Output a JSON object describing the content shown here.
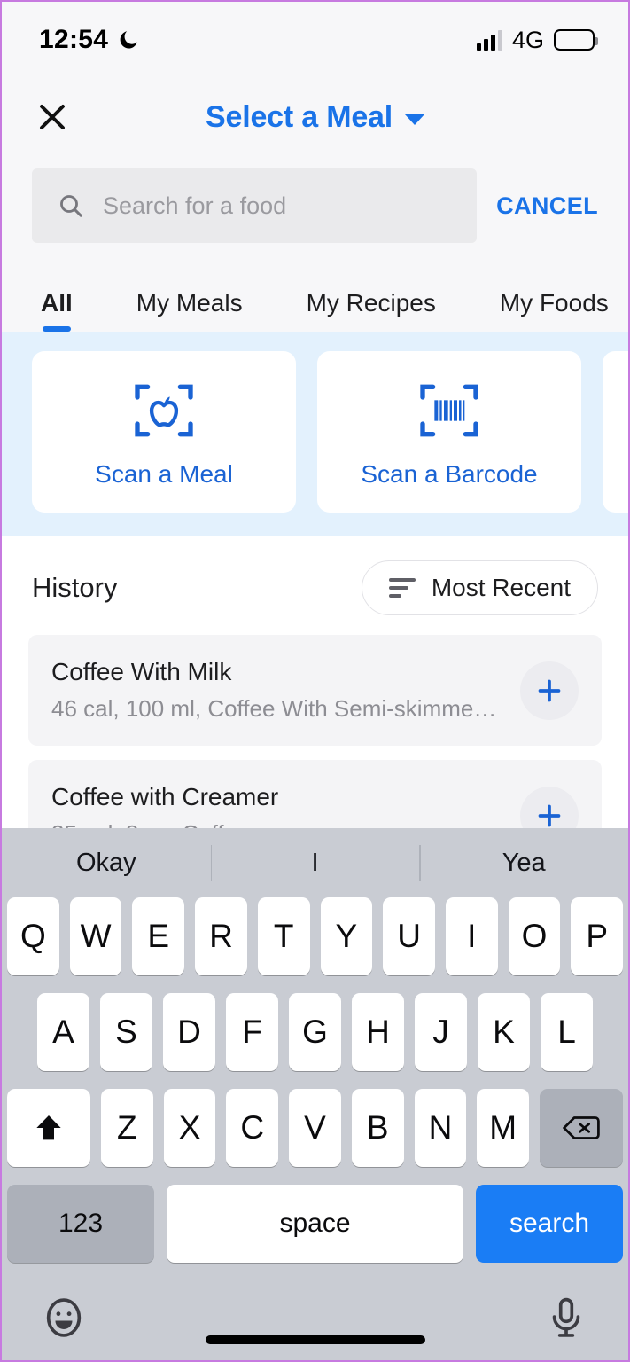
{
  "status_bar": {
    "time": "12:54",
    "dnd_icon": "moon-icon",
    "signal_icon": "cellular-bars-icon",
    "network": "4G",
    "battery_icon": "battery-icon"
  },
  "nav": {
    "close_icon": "close-x-icon",
    "title": "Select a Meal",
    "caret_icon": "chevron-down-icon"
  },
  "search": {
    "icon": "search-icon",
    "placeholder": "Search for a food",
    "value": "",
    "cancel_label": "CANCEL"
  },
  "tabs": [
    {
      "label": "All",
      "active": true
    },
    {
      "label": "My Meals",
      "active": false
    },
    {
      "label": "My Recipes",
      "active": false
    },
    {
      "label": "My Foods",
      "active": false
    }
  ],
  "scan_cards": [
    {
      "label": "Scan a Meal",
      "icon": "scan-apple-icon"
    },
    {
      "label": "Scan a Barcode",
      "icon": "scan-barcode-icon"
    }
  ],
  "history": {
    "title": "History",
    "sort": {
      "label": "Most Recent",
      "icon": "sort-descending-icon"
    },
    "items": [
      {
        "name": "Coffee With Milk",
        "description": "46 cal, 100 ml, Coffee With Semi-skimme…",
        "add_icon": "plus-icon"
      },
      {
        "name": "Coffee with Creamer",
        "description": "35 cal, 8 oz, Coffee",
        "add_icon": "plus-icon"
      }
    ]
  },
  "keyboard": {
    "predictions": [
      "Okay",
      "I",
      "Yea"
    ],
    "row1": [
      "Q",
      "W",
      "E",
      "R",
      "T",
      "Y",
      "U",
      "I",
      "O",
      "P"
    ],
    "row2": [
      "A",
      "S",
      "D",
      "F",
      "G",
      "H",
      "J",
      "K",
      "L"
    ],
    "row3": [
      "Z",
      "X",
      "C",
      "V",
      "B",
      "N",
      "M"
    ],
    "shift_icon": "shift-up-arrow-icon",
    "backspace_icon": "backspace-delete-icon",
    "numbers_label": "123",
    "space_label": "space",
    "search_label": "search",
    "emoji_icon": "emoji-smiley-icon",
    "mic_icon": "microphone-icon"
  },
  "colors": {
    "accent_blue": "#1a73e8",
    "key_blue": "#1a7df5",
    "scan_strip_bg": "#e3f1fd",
    "keyboard_bg": "#c9ccd3"
  }
}
